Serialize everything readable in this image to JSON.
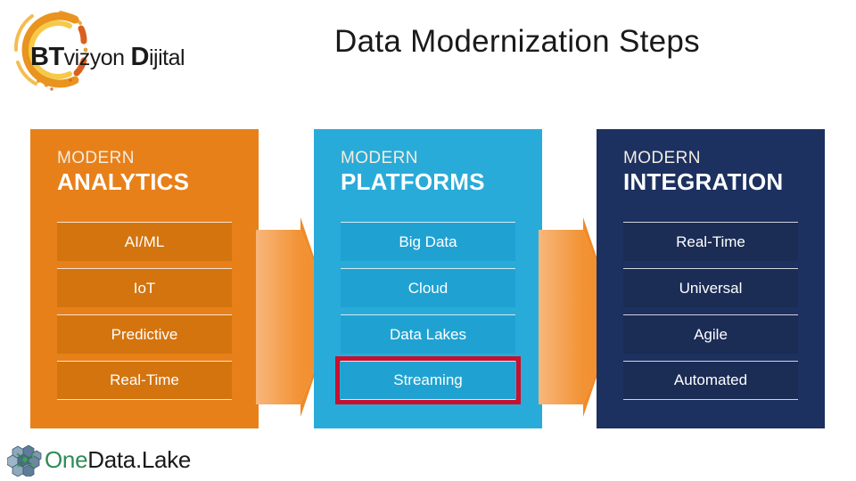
{
  "header": {
    "title": "Data Modernization Steps",
    "brand_logo": {
      "bt": "BT",
      "vizyon": "vizyon",
      "d": "D",
      "ijital": "ijital",
      "icon": "circular-swoosh-icon"
    }
  },
  "footer": {
    "logo": {
      "one": "One",
      "rest": "Data.Lake",
      "icon": "hexagon-cluster-icon"
    }
  },
  "colors": {
    "analytics": "#E8801A",
    "platforms": "#29ABD9",
    "integration": "#1C3160",
    "arrow": "#F08A28",
    "highlight": "#C8102E"
  },
  "columns": [
    {
      "id": "analytics",
      "eyebrow": "MODERN",
      "headline": "ANALYTICS",
      "items": [
        {
          "label": "AI/ML",
          "highlighted": false
        },
        {
          "label": "IoT",
          "highlighted": false
        },
        {
          "label": "Predictive",
          "highlighted": false
        },
        {
          "label": "Real-Time",
          "highlighted": false
        }
      ]
    },
    {
      "id": "platforms",
      "eyebrow": "MODERN",
      "headline": "PLATFORMS",
      "items": [
        {
          "label": "Big Data",
          "highlighted": false
        },
        {
          "label": "Cloud",
          "highlighted": false
        },
        {
          "label": "Data Lakes",
          "highlighted": false
        },
        {
          "label": "Streaming",
          "highlighted": true
        }
      ]
    },
    {
      "id": "integration",
      "eyebrow": "MODERN",
      "headline": "INTEGRATION",
      "items": [
        {
          "label": "Real-Time",
          "highlighted": false
        },
        {
          "label": "Universal",
          "highlighted": false
        },
        {
          "label": "Agile",
          "highlighted": false
        },
        {
          "label": "Automated",
          "highlighted": false
        }
      ]
    }
  ],
  "arrows": [
    {
      "id": "arrow-analytics-to-platforms",
      "icon": "right-chevron-arrow-icon"
    },
    {
      "id": "arrow-platforms-to-integration",
      "icon": "right-chevron-arrow-icon"
    }
  ]
}
